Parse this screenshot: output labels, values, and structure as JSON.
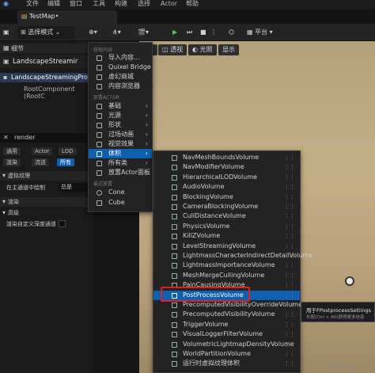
{
  "menubar": {
    "items": [
      "文件",
      "编辑",
      "窗口",
      "工具",
      "构建",
      "选择",
      "Actor",
      "帮助"
    ]
  },
  "tab": {
    "title": "TestMap•"
  },
  "toolbar": {
    "select_mode": "选择模式",
    "platform": "平台"
  },
  "left": {
    "tab_label": "细节",
    "actor_name": "LandscapeStreamir",
    "selected_item": "LandscapeStreamingProxy_",
    "root_component": "RootComponent (RootC",
    "search_value": "render",
    "tags": [
      "通用",
      "Actor",
      "LOD",
      "渲染",
      "流送",
      "所有"
    ],
    "active_tag": "所有",
    "virtual_texture": "虚拟纹理",
    "in_main_pass": "在主通道中绘制",
    "always": "总是",
    "rendering": "渲染",
    "advanced": "高级",
    "custom_depth": "渲染自定义深度通道"
  },
  "viewport": {
    "perspective": "透视",
    "lit": "光照",
    "show": "显示"
  },
  "menu1": {
    "sec_fetch": "获取内容",
    "items_fetch": [
      "导入内容...",
      "Quixel Bridge",
      "虚幻商城",
      "内容浏览器"
    ],
    "sec_place": "放置ACTOR",
    "items_place": [
      "基础",
      "光源",
      "形状",
      "过场动画",
      "视觉效果",
      "体积",
      "所有类",
      "放置Actor面板"
    ],
    "sec_recent": "最近放置",
    "items_recent": [
      "Cone",
      "Cube"
    ],
    "selected": "体积"
  },
  "menu2": {
    "items": [
      "NavMeshBoundsVolume",
      "NavModifierVolume",
      "HierarchicalLODVolume",
      "AudioVolume",
      "BlockingVolume",
      "CameraBlockingVolume",
      "CullDistanceVolume",
      "PhysicsVolume",
      "KillZVolume",
      "LevelStreamingVolume",
      "LightmassCharacterIndirectDetailVolume",
      "LightmassImportanceVolume",
      "MeshMergeCullingVolume",
      "PainCausingVolume",
      "PostProcessVolume",
      "PrecomputedVisibilityOverrideVolume",
      "PrecomputedVisibilityVolume",
      "TriggerVolume",
      "VisualLoggerFilterVolume",
      "VolumetricLightmapDensityVolume",
      "WorldPartitionVolume",
      "运行时虚拟纹理体积"
    ],
    "highlighted": "PostProcessVolume"
  },
  "tooltip": {
    "title": "用于FPostprocessSettings",
    "hint": "长按(Ctrl + Alt)获得更多信息"
  },
  "watermark": "CSDN @jjeep"
}
